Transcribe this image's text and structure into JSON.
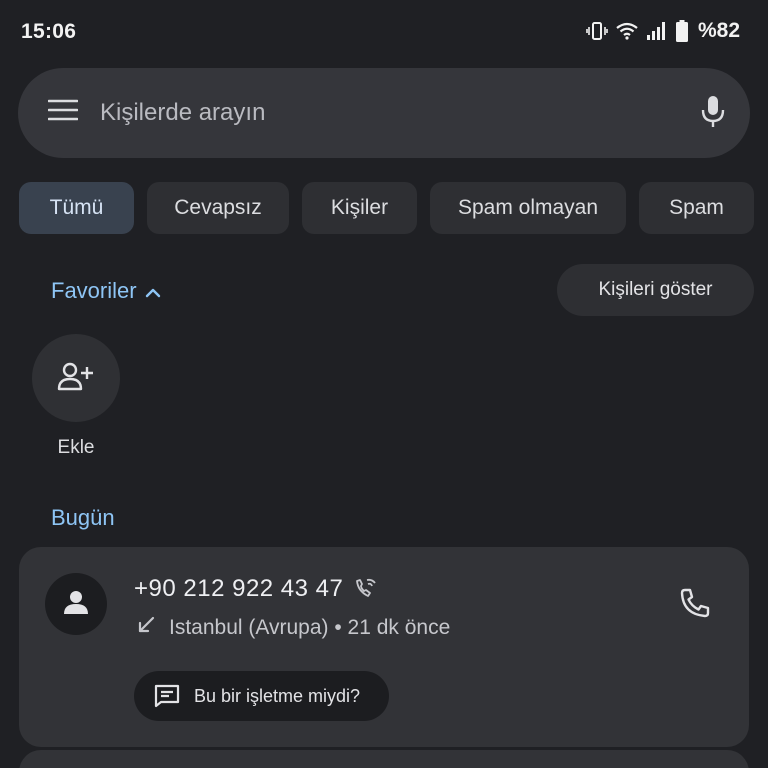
{
  "status": {
    "time": "15:06",
    "battery": "%82"
  },
  "search": {
    "placeholder": "Kişilerde arayın"
  },
  "filters": [
    {
      "label": "Tümü",
      "active": true
    },
    {
      "label": "Cevapsız"
    },
    {
      "label": "Kişiler"
    },
    {
      "label": "Spam olmayan"
    },
    {
      "label": "Spam"
    }
  ],
  "favorites": {
    "title": "Favoriler",
    "show_contacts": "Kişileri göster",
    "add_label": "Ekle"
  },
  "today": {
    "title": "Bugün",
    "call": {
      "number": "+90 212 922 43 47",
      "location": "Istanbul (Avrupa) • 21 dk önce",
      "business_prompt": "Bu bir işletme miydi?"
    }
  },
  "icons": {
    "menu": "menu-icon",
    "mic": "mic-icon",
    "chevron": "chevron-up-icon",
    "add_person": "person-add-icon",
    "avatar": "person-icon",
    "wifi_call": "wifi-call-icon",
    "incoming": "incoming-call-icon",
    "phone": "phone-icon",
    "feedback": "feedback-icon"
  },
  "colors": {
    "background": "#1f2024",
    "accent": "#8ec5f5",
    "chip_active": "#39424f"
  }
}
